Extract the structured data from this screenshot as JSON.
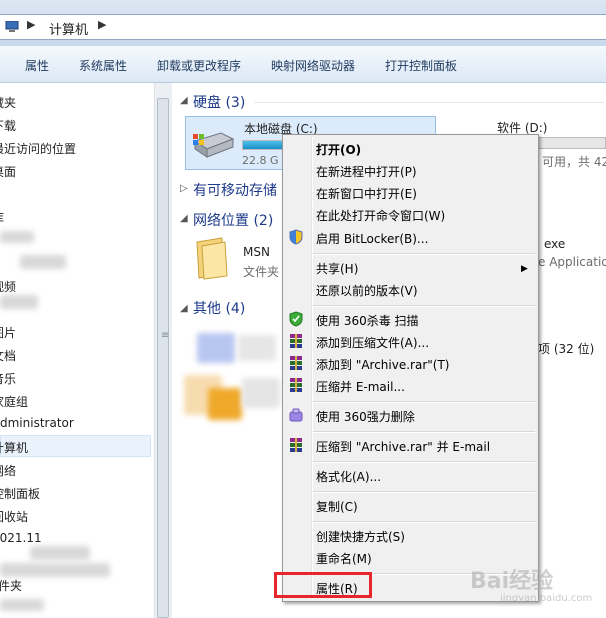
{
  "address": {
    "path": "计算机"
  },
  "toolbar": {
    "items": [
      "属性",
      "系统属性",
      "卸载或更改程序",
      "映射网络驱动器",
      "打开控制面板"
    ]
  },
  "nav": {
    "items": [
      "藏夹",
      "下载",
      "最近访问的位置",
      "桌面",
      "库",
      "视频",
      "图片",
      "文档",
      "音乐",
      "家庭组",
      "Administrator",
      "计算机",
      "网络",
      "控制面板",
      "回收站",
      "2021.11",
      "文件夹"
    ]
  },
  "content": {
    "hard_drives": {
      "title": "硬盘 (3)"
    },
    "drive_c": {
      "name": "本地磁盘 (C:)",
      "free": "22.8 G",
      "fill_percent": 70
    },
    "drive_d": {
      "name": "软件 (D:)",
      "info": "可用，共 42"
    },
    "removable": {
      "title": "有可移动存储"
    },
    "network": {
      "title": "网络位置 (2)"
    },
    "msn": {
      "name": "MSN",
      "type": "文件夹"
    },
    "right_text1": "exe",
    "right_text2": "e Applicatio",
    "other": {
      "title": "其他 (4)"
    },
    "item_32": "项 (32 位)"
  },
  "context_menu": {
    "items": [
      {
        "label": "打开(O)",
        "bold": true
      },
      {
        "label": "在新进程中打开(P)"
      },
      {
        "label": "在新窗口中打开(E)"
      },
      {
        "label": "在此处打开命令窗口(W)"
      },
      {
        "label": "启用 BitLocker(B)...",
        "icon": "shield-uac-icon"
      },
      {
        "label": "共享(H)",
        "submenu": true
      },
      {
        "label": "还原以前的版本(V)"
      },
      {
        "label": "使用 360杀毒 扫描",
        "icon": "360-antivirus-icon"
      },
      {
        "label": "添加到压缩文件(A)...",
        "icon": "winrar-icon"
      },
      {
        "label": "添加到 \"Archive.rar\"(T)",
        "icon": "winrar-icon"
      },
      {
        "label": "压缩并 E-mail...",
        "icon": "winrar-icon"
      },
      {
        "label": "使用 360强力删除",
        "icon": "360-delete-icon"
      },
      {
        "label": "压缩到 \"Archive.rar\" 并 E-mail",
        "icon": "winrar-icon"
      },
      {
        "label": "格式化(A)..."
      },
      {
        "label": "复制(C)"
      },
      {
        "label": "创建快捷方式(S)"
      },
      {
        "label": "重命名(M)"
      },
      {
        "label": "属性(R)"
      }
    ]
  },
  "watermark": {
    "text": "Bai经验",
    "sub": "jingyan.baidu.com"
  },
  "colors": {
    "highlight_box": "#e8262a",
    "menu_bg": "#f0f0f0",
    "link_blue": "#1e3a8a"
  }
}
